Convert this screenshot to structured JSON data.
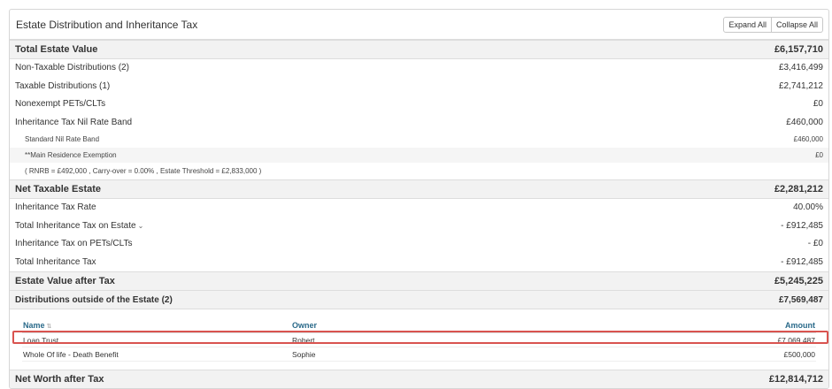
{
  "panel": {
    "title": "Estate Distribution and Inheritance Tax",
    "expand_all": "Expand All",
    "collapse_all": "Collapse All"
  },
  "rows": {
    "total_estate": {
      "label": "Total Estate Value",
      "value": "£6,157,710"
    },
    "non_taxable": {
      "label": "Non-Taxable Distributions (2)",
      "value": "£3,416,499"
    },
    "taxable": {
      "label": "Taxable Distributions (1)",
      "value": "£2,741,212"
    },
    "nonexempt_pets": {
      "label": "Nonexempt PETs/CLTs",
      "value": "£0"
    },
    "nil_rate_band": {
      "label": "Inheritance Tax Nil Rate Band",
      "value": "£460,000"
    },
    "standard_nrb": {
      "label": "Standard Nil Rate Band",
      "value": "£460,000"
    },
    "main_residence": {
      "label": "**Main Residence Exemption",
      "value": "£0"
    },
    "rnrb_note": {
      "label": "( RNRB = £492,000 , Carry-over = 0.00% , Estate Threshold = £2,833,000 )"
    },
    "net_taxable": {
      "label": "Net Taxable Estate",
      "value": "£2,281,212"
    },
    "tax_rate": {
      "label": "Inheritance Tax Rate",
      "value": "40.00%"
    },
    "total_iht_estate": {
      "label": "Total Inheritance Tax on Estate",
      "value": "- £912,485"
    },
    "iht_pets": {
      "label": "Inheritance Tax on PETs/CLTs",
      "value": "- £0"
    },
    "total_iht": {
      "label": "Total Inheritance Tax",
      "value": "- £912,485"
    },
    "value_after_tax": {
      "label": "Estate Value after Tax",
      "value": "£5,245,225"
    },
    "outside_estate": {
      "label": "Distributions outside of the Estate (2)",
      "value": "£7,569,487"
    },
    "net_worth": {
      "label": "Net Worth after Tax",
      "value": "£12,814,712"
    }
  },
  "distributions": {
    "headers": {
      "name": "Name",
      "owner": "Owner",
      "amount": "Amount"
    },
    "items": [
      {
        "name": "Loan Trust",
        "owner": "Robert",
        "amount": "£7,069,487"
      },
      {
        "name": "Whole Of life - Death Benefit",
        "owner": "Sophie",
        "amount": "£500,000"
      }
    ]
  },
  "icons": {
    "caret": "chevron-down-icon",
    "sort": "sort-icon"
  },
  "colors": {
    "header_link": "#2a6a8a",
    "highlight": "#d9534f",
    "row_shade": "#f2f2f2"
  }
}
